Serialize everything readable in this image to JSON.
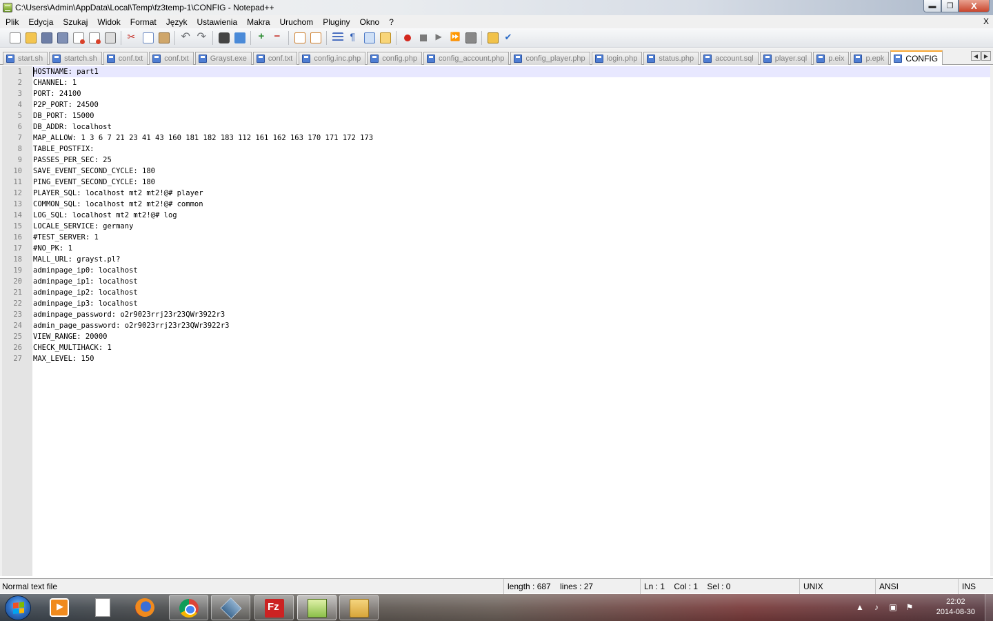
{
  "window": {
    "title": "C:\\Users\\Admin\\AppData\\Local\\Temp\\fz3temp-1\\CONFIG - Notepad++",
    "min_label": "▬",
    "max_label": "❐",
    "close_label": "X"
  },
  "menu": {
    "items": [
      "Plik",
      "Edycja",
      "Szukaj",
      "Widok",
      "Format",
      "Język",
      "Ustawienia",
      "Makra",
      "Uruchom",
      "Pluginy",
      "Okno",
      "?"
    ],
    "close_doc": "X"
  },
  "toolbar": {
    "icons": [
      "new-file-icon",
      "open-file-icon",
      "save-icon",
      "save-all-icon",
      "close-file-icon",
      "close-all-icon",
      "print-icon",
      "cut-icon",
      "copy-icon",
      "paste-icon",
      "undo-icon",
      "redo-icon",
      "find-icon",
      "replace-icon",
      "zoom-in-icon",
      "zoom-out-icon",
      "sync-vertical-icon",
      "sync-horizontal-icon",
      "word-wrap-icon",
      "show-all-chars-icon",
      "indent-guide-icon",
      "user-language-icon",
      "macro-record-icon",
      "macro-stop-icon",
      "macro-play-icon",
      "macro-play-multiple-icon",
      "macro-save-icon",
      "function-list-icon",
      "spell-check-icon"
    ]
  },
  "tabs": {
    "items": [
      "start.sh",
      "startch.sh",
      "conf.txt",
      "conf.txt",
      "Grayst.exe",
      "conf.txt",
      "config.inc.php",
      "config.php",
      "config_account.php",
      "config_player.php",
      "login.php",
      "status.php",
      "account.sql",
      "player.sql",
      "p.eix",
      "p.epk",
      "CONFIG"
    ],
    "active_index": 16,
    "prev_label": "◀",
    "next_label": "▶"
  },
  "editor": {
    "lines": [
      "HOSTNAME: part1",
      "CHANNEL: 1",
      "PORT: 24100",
      "P2P_PORT: 24500",
      "DB_PORT: 15000",
      "DB_ADDR: localhost",
      "MAP_ALLOW: 1 3 6 7 21 23 41 43 160 181 182 183 112 161 162 163 170 171 172 173",
      "TABLE_POSTFIX:",
      "PASSES_PER_SEC: 25",
      "SAVE_EVENT_SECOND_CYCLE: 180",
      "PING_EVENT_SECOND_CYCLE: 180",
      "PLAYER_SQL: localhost mt2 mt2!@# player",
      "COMMON_SQL: localhost mt2 mt2!@# common",
      "LOG_SQL: localhost mt2 mt2!@# log",
      "LOCALE_SERVICE: germany",
      "#TEST_SERVER: 1",
      "#NO_PK: 1",
      "MALL_URL: grayst.pl?",
      "adminpage_ip0: localhost",
      "adminpage_ip1: localhost",
      "adminpage_ip2: localhost",
      "adminpage_ip3: localhost",
      "adminpage_password: o2r9023rrj23r23QWr3922r3",
      "admin_page_password: o2r9023rrj23r23QWr3922r3",
      "VIEW_RANGE: 20000",
      "CHECK_MULTIHACK: 1",
      "MAX_LEVEL: 150"
    ]
  },
  "status": {
    "file_type": "Normal text file",
    "length": "length : 687",
    "lines": "lines : 27",
    "ln": "Ln : 1",
    "col": "Col : 1",
    "sel": "Sel : 0",
    "eol": "UNIX",
    "encoding": "ANSI",
    "mode": "INS"
  },
  "taskbar": {
    "apps": [
      "media-player-icon",
      "document-icon",
      "firefox-icon",
      "chrome-icon",
      "virtualbox-icon",
      "filezilla-icon",
      "notepadpp-icon",
      "explorer-icon"
    ],
    "time": "22:02",
    "date": "2014-08-30"
  },
  "colors": {
    "current_line": "#e8e8ff",
    "active_tab_accent": "#f7a632",
    "gutter": "#e4e4e4"
  }
}
